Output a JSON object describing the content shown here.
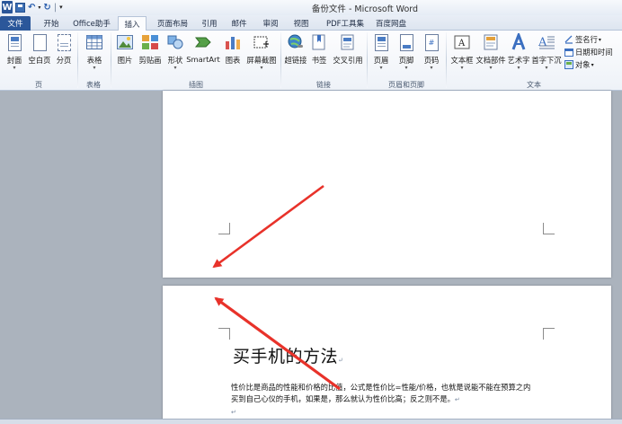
{
  "window": {
    "title": "备份文件 - Microsoft Word"
  },
  "quick_access": {
    "app_icon": "word-icon",
    "save": "save-icon",
    "undo": "undo-icon",
    "redo": "redo-icon"
  },
  "tabs": [
    {
      "label": "文件"
    },
    {
      "label": "开始"
    },
    {
      "label": "Office助手"
    },
    {
      "label": "插入"
    },
    {
      "label": "页面布局"
    },
    {
      "label": "引用"
    },
    {
      "label": "邮件"
    },
    {
      "label": "审阅"
    },
    {
      "label": "视图"
    },
    {
      "label": "PDF工具集"
    },
    {
      "label": "百度网盘"
    }
  ],
  "ribbon": {
    "pages": {
      "cover": "封面",
      "blank": "空白页",
      "break": "分页",
      "group": "页"
    },
    "tables": {
      "table": "表格",
      "group": "表格"
    },
    "illustrations": {
      "picture": "图片",
      "clipart": "剪贴画",
      "shapes": "形状",
      "smartart": "SmartArt",
      "chart": "图表",
      "screenshot": "屏幕截图",
      "group": "插图"
    },
    "links": {
      "hyperlink": "超链接",
      "bookmark": "书签",
      "crossref": "交叉引用",
      "group": "链接"
    },
    "header_footer": {
      "header": "页眉",
      "footer": "页脚",
      "page_number": "页码",
      "group": "页眉和页脚"
    },
    "text": {
      "textbox": "文本框",
      "quickparts": "文档部件",
      "wordart": "艺术字",
      "dropcap": "首字下沉",
      "signature": "签名行",
      "datetime": "日期和时间",
      "object": "对象",
      "group": "文本"
    }
  },
  "document": {
    "title": "买手机的方法",
    "para_lines": [
      "性价比是商品的性能和价格的比值，公式是性价比=性能/价格，也就是说能不能在预算之内",
      "买到自己心仪的手机，如果是，那么就认为性价比高；反之则不是。"
    ],
    "colors": {
      "arrow": "#e8322a",
      "ribbon_tab_file": "#2b579a",
      "workspace": "#abb3bd"
    }
  }
}
